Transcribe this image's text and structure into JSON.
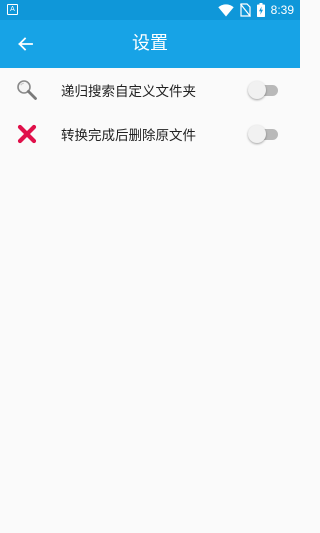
{
  "status_bar": {
    "app_badge": "A",
    "time": "8:39",
    "icons": [
      "wifi-icon",
      "no-sim-icon",
      "battery-charging-icon"
    ]
  },
  "app_bar": {
    "title": "设置",
    "back_icon": "arrow-left-icon"
  },
  "settings": [
    {
      "icon": "magnifier-icon",
      "label": "递归搜索自定义文件夹",
      "enabled": false
    },
    {
      "icon": "red-x-icon",
      "label": "转换完成后删除原文件",
      "enabled": false
    }
  ],
  "colors": {
    "status_bar": "#0f97d9",
    "app_bar": "#17a3e6",
    "background": "#fafafa",
    "delete_icon": "#e0104a",
    "toggle_track_off": "#b9b9b9",
    "toggle_thumb_off": "#f1f1f1"
  }
}
